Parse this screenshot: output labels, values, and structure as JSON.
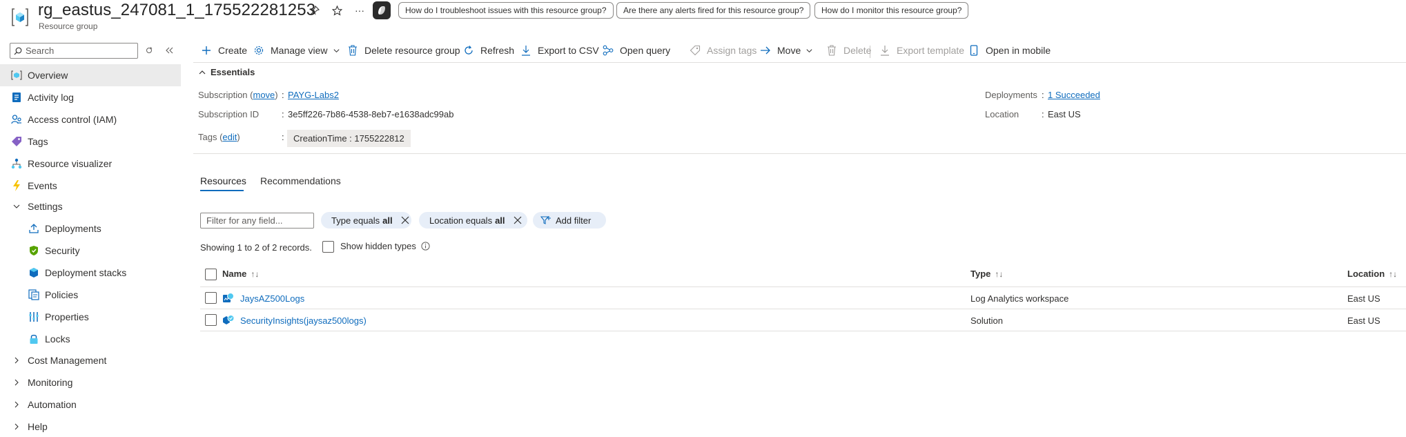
{
  "header": {
    "title": "rg_eastus_247081_1_175522281253",
    "subtitle": "Resource group",
    "more": "···",
    "suggestions": [
      "How do I troubleshoot issues with this resource group?",
      "Are there any alerts fired for this resource group?",
      "How do I monitor this resource group?"
    ]
  },
  "sidebar": {
    "search_placeholder": "Search",
    "items": [
      {
        "label": "Overview",
        "icon": "overview-icon",
        "active": true
      },
      {
        "label": "Activity log",
        "icon": "activity-log-icon"
      },
      {
        "label": "Access control (IAM)",
        "icon": "iam-icon"
      },
      {
        "label": "Tags",
        "icon": "tag-icon"
      },
      {
        "label": "Resource visualizer",
        "icon": "visualizer-icon"
      },
      {
        "label": "Events",
        "icon": "lightning-icon"
      },
      {
        "label": "Settings",
        "icon": "chevron-down-icon"
      },
      {
        "label": "Deployments",
        "icon": "deployments-icon"
      },
      {
        "label": "Security",
        "icon": "shield-icon"
      },
      {
        "label": "Deployment stacks",
        "icon": "stack-icon"
      },
      {
        "label": "Policies",
        "icon": "policy-icon"
      },
      {
        "label": "Properties",
        "icon": "properties-icon"
      },
      {
        "label": "Locks",
        "icon": "lock-icon"
      },
      {
        "label": "Cost Management",
        "icon": "chevron-right-icon"
      },
      {
        "label": "Monitoring",
        "icon": "chevron-right-icon"
      },
      {
        "label": "Automation",
        "icon": "chevron-right-icon"
      },
      {
        "label": "Help",
        "icon": "chevron-right-icon"
      }
    ]
  },
  "toolbar": {
    "create": "Create",
    "manage_view": "Manage view",
    "delete_rg": "Delete resource group",
    "refresh": "Refresh",
    "export_csv": "Export to CSV",
    "open_query": "Open query",
    "assign_tags": "Assign tags",
    "move": "Move",
    "delete": "Delete",
    "export_template": "Export template",
    "open_mobile": "Open in mobile"
  },
  "essentials": {
    "heading": "Essentials",
    "subscription_label": "Subscription (",
    "subscription_move": "move",
    "subscription_label_end": ")",
    "subscription_value": "PAYG-Labs2",
    "subscription_id_label": "Subscription ID",
    "subscription_id_value": "3e5ff226-7b86-4538-8eb7-e1638adc99ab",
    "tags_label": "Tags (",
    "tags_edit": "edit",
    "tags_label_end": ")",
    "tag_value": "CreationTime : 1755222812",
    "deployments_label": "Deployments",
    "deployments_value": "1 Succeeded",
    "location_label": "Location",
    "location_value": "East US",
    "colon": ":"
  },
  "tabs": [
    "Resources",
    "Recommendations"
  ],
  "filters": {
    "placeholder": "Filter for any field...",
    "type_prefix": "Type equals",
    "type_value": "all",
    "location_prefix": "Location equals",
    "location_value": "all",
    "add_filter": "Add filter"
  },
  "records_text": "Showing 1 to 2 of 2 records.",
  "show_hidden": "Show hidden types",
  "table": {
    "columns": [
      {
        "label": "Name",
        "sort": "↑↓"
      },
      {
        "label": "Type",
        "sort": "↑↓"
      },
      {
        "label": "Location",
        "sort": "↑↓"
      }
    ],
    "rows": [
      {
        "name": "JaysAZ500Logs",
        "type": "Log Analytics workspace",
        "location": "East US",
        "icon": "log-analytics-icon"
      },
      {
        "name": "SecurityInsights(jaysaz500logs)",
        "type": "Solution",
        "location": "East US",
        "icon": "solution-icon"
      }
    ]
  },
  "colors": {
    "accent": "#0f6cbd",
    "active_nav": "#ebebeb",
    "pill": "#e7eef8"
  }
}
